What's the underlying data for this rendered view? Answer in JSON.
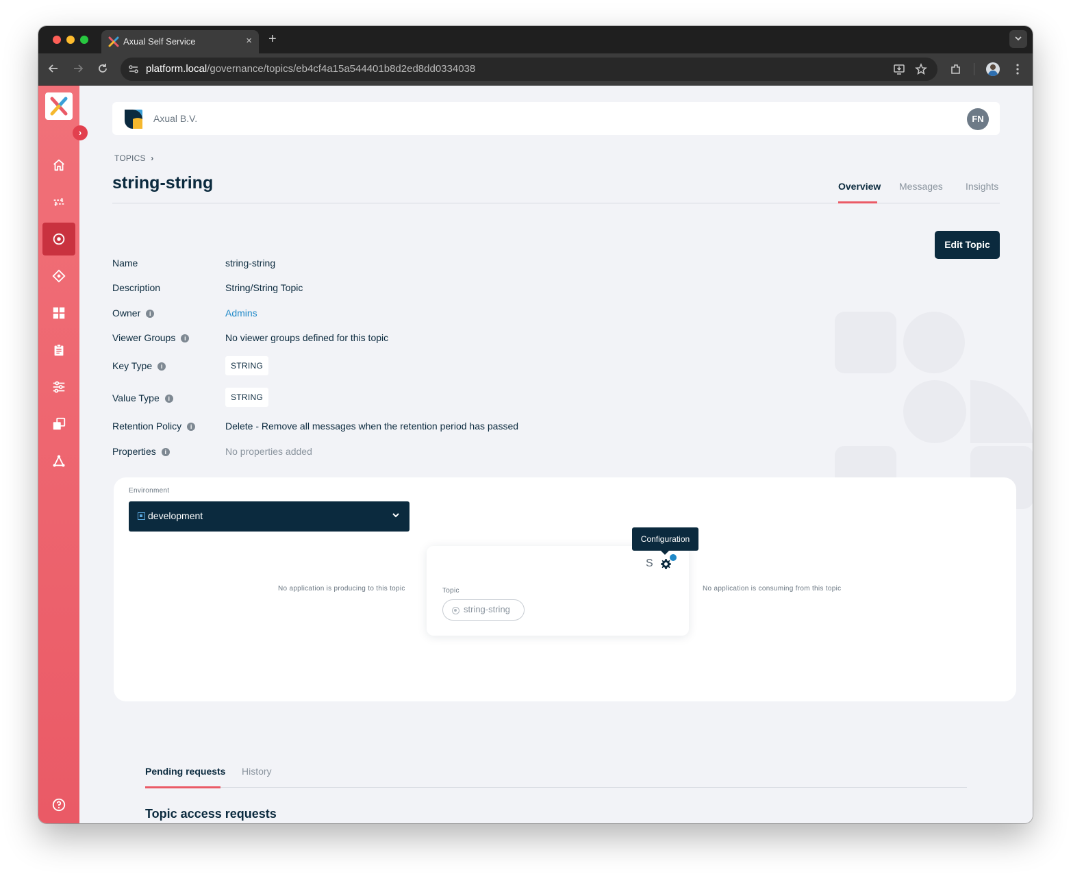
{
  "browser": {
    "tab_title": "Axual Self Service",
    "tab_close": "×",
    "new_tab": "+",
    "url_host": "platform.local",
    "url_path": "/governance/topics/eb4cf4a15a544401b8d2ed8dd0334038"
  },
  "header": {
    "org_name": "Axual B.V.",
    "avatar_initials": "FN"
  },
  "sidebar": {
    "expand_icon": "›",
    "items": [
      {
        "icon": "home-icon",
        "active": false
      },
      {
        "icon": "streams-icon",
        "active": false
      },
      {
        "icon": "topic-icon",
        "active": true
      },
      {
        "icon": "schema-icon",
        "active": false
      },
      {
        "icon": "applications-icon",
        "active": false
      },
      {
        "icon": "clipboard-icon",
        "active": false
      },
      {
        "icon": "settings-sliders-icon",
        "active": false
      },
      {
        "icon": "copy-icon",
        "active": false
      },
      {
        "icon": "network-icon",
        "active": false
      }
    ],
    "help_icon": "help-icon"
  },
  "breadcrumb": {
    "label": "TOPICS",
    "separator": "›"
  },
  "page": {
    "title": "string-string",
    "tabs": [
      {
        "label": "Overview",
        "active": true
      },
      {
        "label": "Messages",
        "active": false
      },
      {
        "label": "Insights",
        "active": false
      }
    ],
    "edit_button": "Edit Topic"
  },
  "details": {
    "name_label": "Name",
    "name_value": "string-string",
    "description_label": "Description",
    "description_value": "String/String Topic",
    "owner_label": "Owner",
    "owner_value": "Admins",
    "viewer_groups_label": "Viewer Groups",
    "viewer_groups_value": "No viewer groups defined for this topic",
    "key_type_label": "Key Type",
    "key_type_value": "STRING",
    "value_type_label": "Value Type",
    "value_type_value": "STRING",
    "retention_label": "Retention Policy",
    "retention_value": "Delete - Remove all messages when the retention period has passed",
    "properties_label": "Properties",
    "properties_value": "No properties added",
    "info_glyph": "i"
  },
  "environment": {
    "label": "Environment",
    "selected": "development",
    "producers_text": "No application is producing to this topic",
    "consumers_text": "No application is consuming from this topic",
    "topic_card": {
      "s_label": "S",
      "label": "Topic",
      "topic_name": "string-string"
    },
    "tooltip": "Configuration"
  },
  "requests": {
    "tabs": [
      {
        "label": "Pending requests",
        "active": true
      },
      {
        "label": "History",
        "active": false
      }
    ],
    "section_title": "Topic access requests"
  },
  "colors": {
    "brand_red": "#ea5a66",
    "navy": "#0b2a3e",
    "link_blue": "#1e88c7"
  }
}
